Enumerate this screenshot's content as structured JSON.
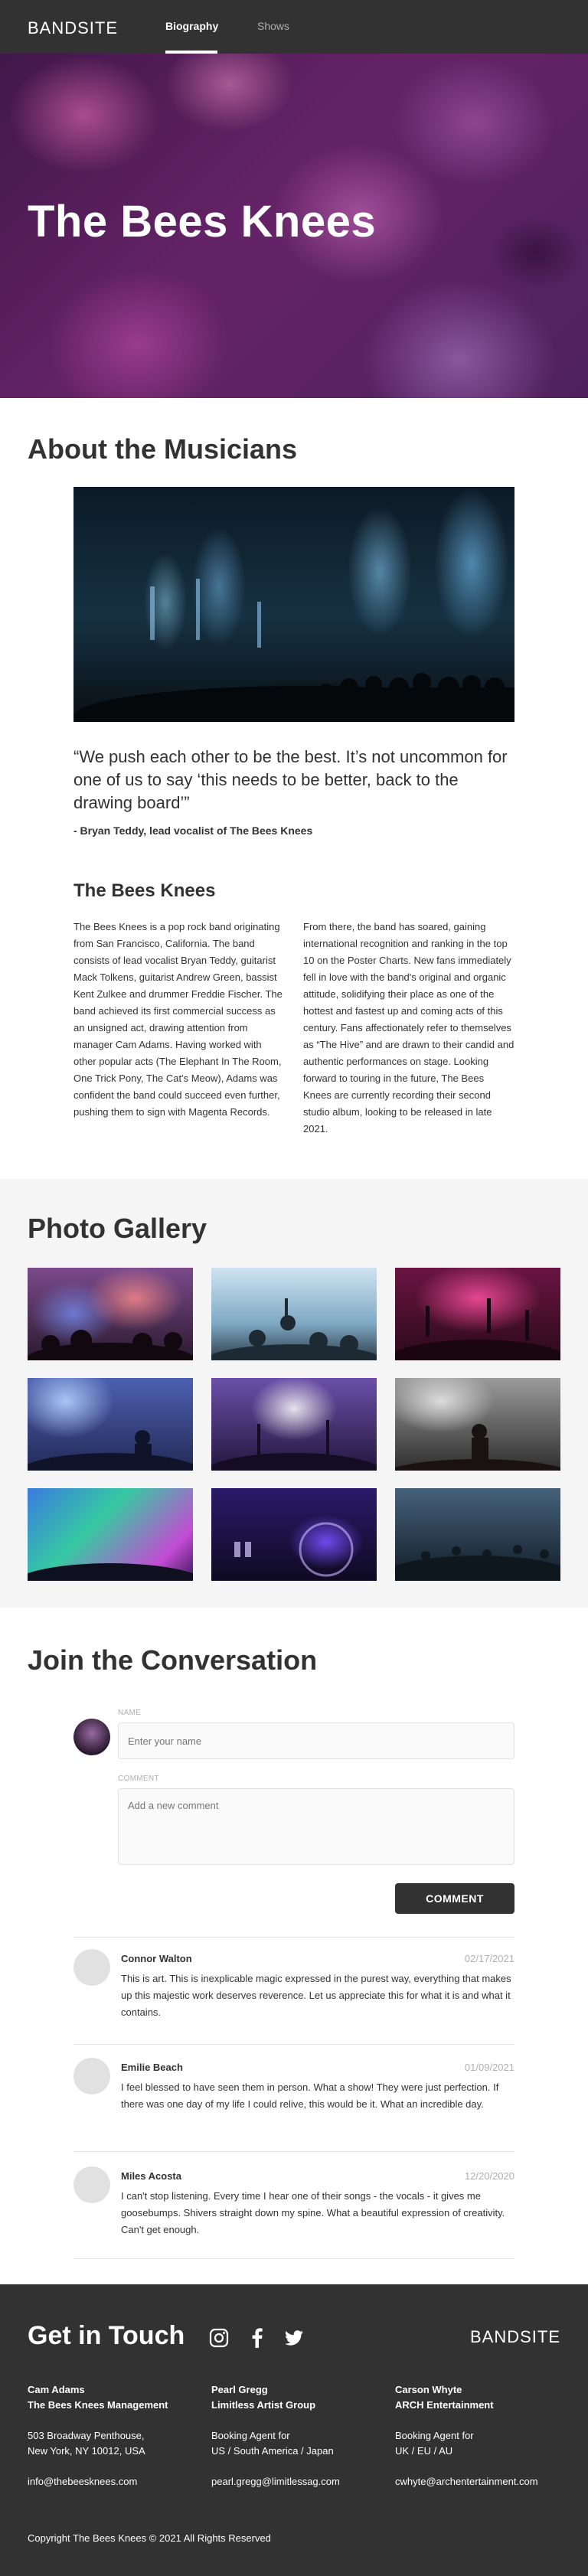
{
  "header": {
    "logo": "BANDSITE",
    "nav": [
      {
        "label": "Biography"
      },
      {
        "label": "Shows"
      }
    ]
  },
  "hero": {
    "title": "The Bees Knees"
  },
  "about": {
    "title": "About the Musicians",
    "quote": "“We push each other to be the best. It’s not uncommon for one of us to say ‘this needs to be better, back to the drawing board’”",
    "author": "- Bryan Teddy, lead vocalist of The Bees Knees",
    "subtitle": "The Bees Knees",
    "col1": "The Bees Knees is a pop rock band originating from San Francisco, California. The band consists of lead vocalist Bryan Teddy, guitarist Mack Tolkens, guitarist Andrew Green, bassist Kent Zulkee and drummer Freddie Fischer. The band achieved its first commercial success as an unsigned act, drawing attention from manager Cam Adams. Having worked with other popular acts (The Elephant In The Room, One Trick Pony, The Cat's Meow), Adams was confident the band could succeed even further, pushing them to sign with Magenta Records.",
    "col2": "From there, the band has soared, gaining international recognition and ranking in the top 10 on the Poster Charts. New fans immediately fell in love with the band's original and organic attitude, solidifying their place as one of the hottest and fastest up and coming acts of this century. Fans affectionately refer to themselves as “The Hive” and are drawn to their candid and authentic performances on stage. Looking forward to touring in the future, The Bees Knees are currently recording their second studio album, looking to be released in late 2021."
  },
  "gallery": {
    "title": "Photo Gallery"
  },
  "conversation": {
    "title": "Join the Conversation",
    "name_label": "NAME",
    "name_placeholder": "Enter your name",
    "comment_label": "COMMENT",
    "comment_placeholder": "Add a new comment",
    "button": "COMMENT",
    "comments": [
      {
        "name": "Connor Walton",
        "date": "02/17/2021",
        "text": "This is art. This is inexplicable magic expressed in the purest way, everything that makes up this majestic work deserves reverence. Let us appreciate this for what it is and what it contains."
      },
      {
        "name": "Emilie Beach",
        "date": "01/09/2021",
        "text": "I feel blessed to have seen them in person. What a show! They were just perfection. If there was one day of my life I could relive, this would be it. What an incredible day."
      },
      {
        "name": "Miles Acosta",
        "date": "12/20/2020",
        "text": "I can't stop listening. Every time I hear one of their songs - the vocals - it gives me goosebumps. Shivers straight down my spine. What a beautiful expression of creativity. Can't get enough."
      }
    ]
  },
  "footer": {
    "title": "Get in Touch",
    "logo": "BANDSITE",
    "contacts": [
      {
        "name": "Cam Adams",
        "org": "The Bees Knees Management",
        "line1": "503 Broadway Penthouse,",
        "line2": "New York, NY 10012, USA",
        "email": "info@thebeesknees.com"
      },
      {
        "name": "Pearl Gregg",
        "org": "Limitless Artist Group",
        "line1": "Booking Agent for",
        "line2": "US / South America / Japan",
        "email": "pearl.gregg@limitlessag.com"
      },
      {
        "name": "Carson Whyte",
        "org": "ARCH Entertainment",
        "line1": "Booking Agent for",
        "line2": "UK / EU / AU",
        "email": "cwhyte@archentertainment.com"
      }
    ],
    "copyright": "Copyright The Bees Knees © 2021 All Rights Reserved"
  }
}
